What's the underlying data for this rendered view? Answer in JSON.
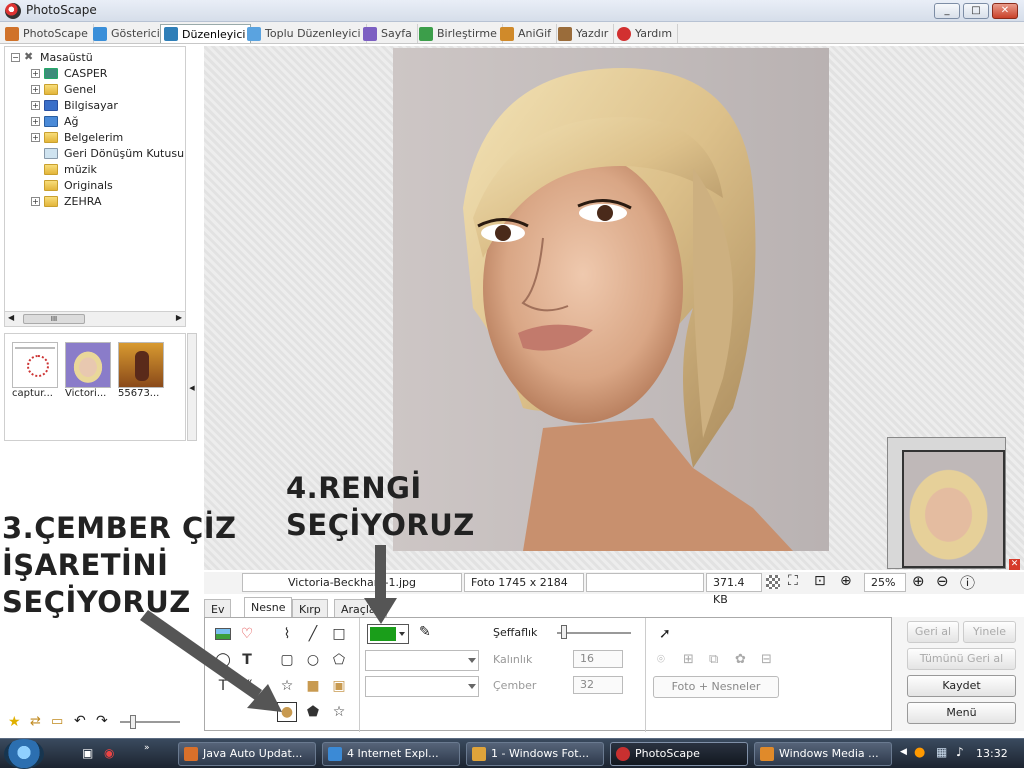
{
  "window": {
    "title": "PhotoScape",
    "min": "_",
    "max": "□",
    "close": "✕"
  },
  "tabs": [
    {
      "label": "PhotoScape",
      "color": "#d0722a"
    },
    {
      "label": "Gösterici",
      "color": "#3a8fd9"
    },
    {
      "label": "Düzenleyici",
      "color": "#2f7fb8"
    },
    {
      "label": "Toplu Düzenleyici",
      "color": "#5aa3e0"
    },
    {
      "label": "Sayfa",
      "color": "#7c5fc2"
    },
    {
      "label": "Birleştirme",
      "color": "#3c9e4a"
    },
    {
      "label": "AniGif",
      "color": "#d08a2a"
    },
    {
      "label": "Yazdır",
      "color": "#9a6c3a"
    },
    {
      "label": "Yardım",
      "color": "#d23030"
    }
  ],
  "tree": {
    "root": "Masaüstü",
    "items": [
      "CASPER",
      "Genel",
      "Bilgisayar",
      "Ağ",
      "Belgelerim",
      "Geri Dönüşüm Kutusu",
      "müzik",
      "Originals",
      "ZEHRA"
    ]
  },
  "scrollbar": {
    "thumb_label": "III"
  },
  "thumbnails": [
    {
      "label": "captur..."
    },
    {
      "label": "Victori..."
    },
    {
      "label": "55673..."
    }
  ],
  "status": {
    "filename": "Victoria-Beckham-1.jpg",
    "photo_size": "Foto 1745 x 2184",
    "file_size": "371.4 KB",
    "zoom": "25%"
  },
  "bottom_tabs": [
    "Ev",
    "Nesne",
    "Kırp",
    "Araçlar"
  ],
  "object_panel": {
    "transparency_label": "Şeffaflık",
    "thickness_label": "Kalınlık",
    "thickness_value": "16",
    "circle_label": "Çember",
    "circle_value": "32",
    "photo_objects_button": "Foto + Nesneler",
    "selected_color": "#1a9e1a",
    "transparency_level": 0.0
  },
  "side_buttons": {
    "undo": "Geri al",
    "redo": "Yinele",
    "undo_all": "Tümünü Geri al",
    "save": "Kaydet",
    "menu": "Menü"
  },
  "annotations": {
    "step3_line1": "3.ÇEMBER ÇİZ",
    "step3_line2": "İŞARETİNİ",
    "step3_line3": "SEÇİYORUZ",
    "step4_line1": "4.RENGİ",
    "step4_line2": "SEÇİYORUZ"
  },
  "taskbar": {
    "items": [
      {
        "label": "Java Auto Updat...",
        "color": "#d9702a"
      },
      {
        "label": "4 Internet Expl...",
        "color": "#3b8ad6"
      },
      {
        "label": "1 - Windows Fot...",
        "color": "#e0a43a"
      },
      {
        "label": "PhotoScape",
        "color": "#c83030"
      },
      {
        "label": "Windows Media ...",
        "color": "#e08a2a"
      }
    ],
    "clock": "13:32"
  }
}
